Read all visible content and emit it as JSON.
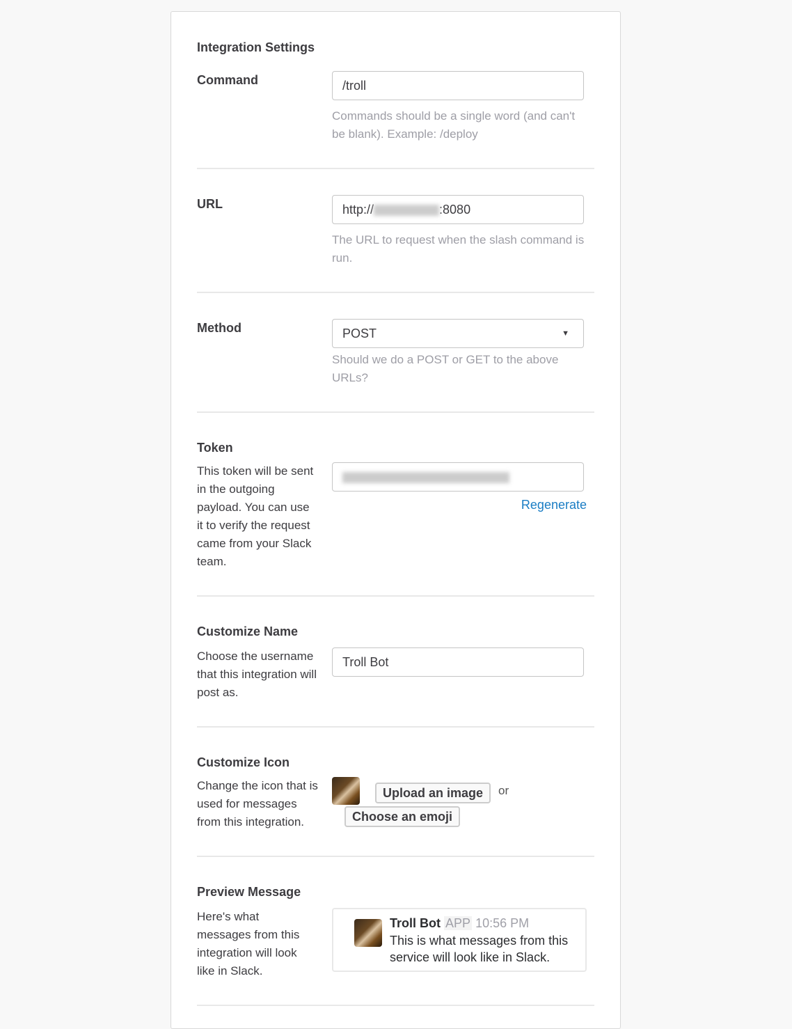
{
  "section_title": "Integration Settings",
  "command": {
    "label": "Command",
    "value": "/troll",
    "help": "Commands should be a single word (and can't be blank). Example: /deploy"
  },
  "url": {
    "label": "URL",
    "prefix": "http://",
    "suffix": ":8080",
    "help": "The URL to request when the slash command is run."
  },
  "method": {
    "label": "Method",
    "value": "POST",
    "help": "Should we do a POST or GET to the above URLs?"
  },
  "token": {
    "label": "Token",
    "description": "This token will be sent in the outgoing payload. You can use it to verify the request came from your Slack team.",
    "regenerate": "Regenerate"
  },
  "name": {
    "label": "Customize Name",
    "description": "Choose the username that this integration will post as.",
    "value": "Troll Bot"
  },
  "icon": {
    "label": "Customize Icon",
    "description": "Change the icon that is used for messages from this integration.",
    "upload": "Upload an image",
    "or": "or",
    "emoji": "Choose an emoji"
  },
  "preview": {
    "label": "Preview Message",
    "description": "Here's what messages from this integration will look like in Slack.",
    "bot_name": "Troll Bot",
    "badge": "APP",
    "time": "10:56 PM",
    "message": "This is what messages from this service will look like in Slack."
  },
  "colors": {
    "link": "#1a7dc4",
    "help": "#9e9ea6"
  }
}
